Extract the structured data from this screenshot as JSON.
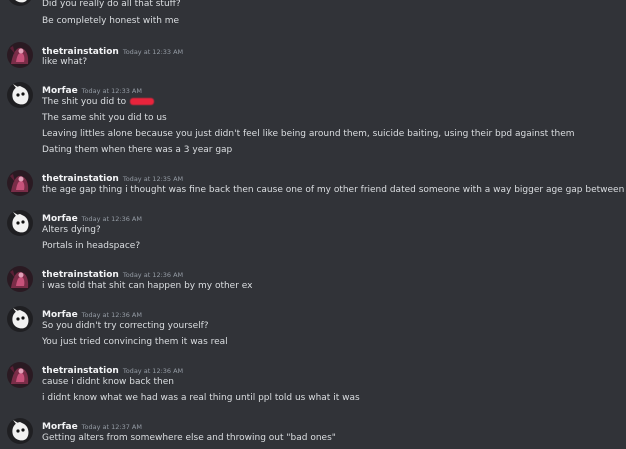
{
  "messages_top": [
    "Did you really do all that stuff?",
    "Be completely honest with me"
  ],
  "groups": [
    {
      "author": "thetrainstation",
      "time": "Today at 12:33 AM",
      "lines": [
        "like what?"
      ]
    },
    {
      "author": "Morfae",
      "time": "Today at 12:33 AM",
      "lines": [
        "The shit you did to",
        "The same shit you did to us",
        "Leaving littles alone because you just didn't feel like being around them, suicide baiting, using their bpd against them",
        "Dating them when there was a 3 year gap"
      ]
    },
    {
      "author": "thetrainstation",
      "time": "Today at 12:35 AM",
      "lines": [
        "the age gap thing i thought was fine back then cause one of my other friend dated someone with a way bigger age gap between them"
      ]
    },
    {
      "author": "Morfae",
      "time": "Today at 12:36 AM",
      "lines": [
        "Alters dying?",
        "Portals in headspace?"
      ]
    },
    {
      "author": "thetrainstation",
      "time": "Today at 12:36 AM",
      "lines": [
        "i was told that shit can happen by my other ex"
      ]
    },
    {
      "author": "Morfae",
      "time": "Today at 12:36 AM",
      "lines": [
        "So you didn't try correcting yourself?",
        "You just tried convincing them it was real"
      ]
    },
    {
      "author": "thetrainstation",
      "time": "Today at 12:36 AM",
      "lines": [
        "cause i didnt know back then",
        "i didnt know what we had was a real thing until ppl told us what it was"
      ]
    },
    {
      "author": "Morfae",
      "time": "Today at 12:37 AM",
      "lines": [
        "Getting alters from somewhere else and throwing out \"bad ones\""
      ]
    }
  ],
  "colors": {
    "background": "#313338",
    "username": "#f2f3f5",
    "text": "#dbdee1",
    "timestamp": "#949ba4",
    "redaction": "#e8243c"
  },
  "icons": {
    "morfae_avatar": "white-creature-avatar-icon",
    "thetrainstation_avatar": "dark-pink-avatar-icon"
  }
}
